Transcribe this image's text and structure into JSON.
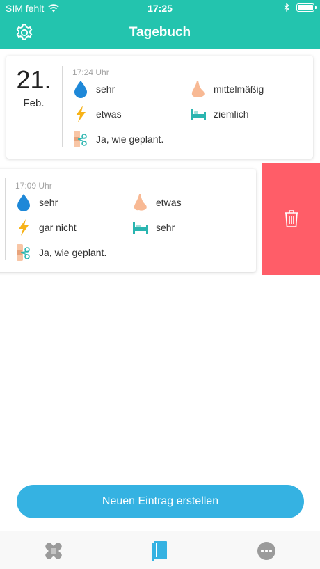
{
  "status": {
    "carrier": "SIM fehlt",
    "time": "17:25"
  },
  "header": {
    "title": "Tagebuch"
  },
  "entries": [
    {
      "day": "21.",
      "month": "Feb.",
      "time": "17:24 Uhr",
      "water": "sehr",
      "nose": "mittelmäßig",
      "energy": "etwas",
      "sleep": "ziemlich",
      "plan": "Ja, wie geplant."
    },
    {
      "time": "17:09 Uhr",
      "water": "sehr",
      "nose": "etwas",
      "energy": "gar nicht",
      "sleep": "sehr",
      "plan": "Ja, wie geplant."
    }
  ],
  "actions": {
    "new_entry": "Neuen Eintrag erstellen"
  },
  "colors": {
    "primary": "#23c4ae",
    "delete": "#ff5d68",
    "button": "#35b2e2",
    "tab_active": "#35b2e2",
    "tab_inactive": "#9b9b9b"
  },
  "icons": [
    "settings-gear-icon",
    "water-drop-icon",
    "nose-icon",
    "lightning-icon",
    "bed-icon",
    "plaster-scissors-icon",
    "trash-icon",
    "plaster-icon",
    "diary-book-icon",
    "more-icon"
  ]
}
